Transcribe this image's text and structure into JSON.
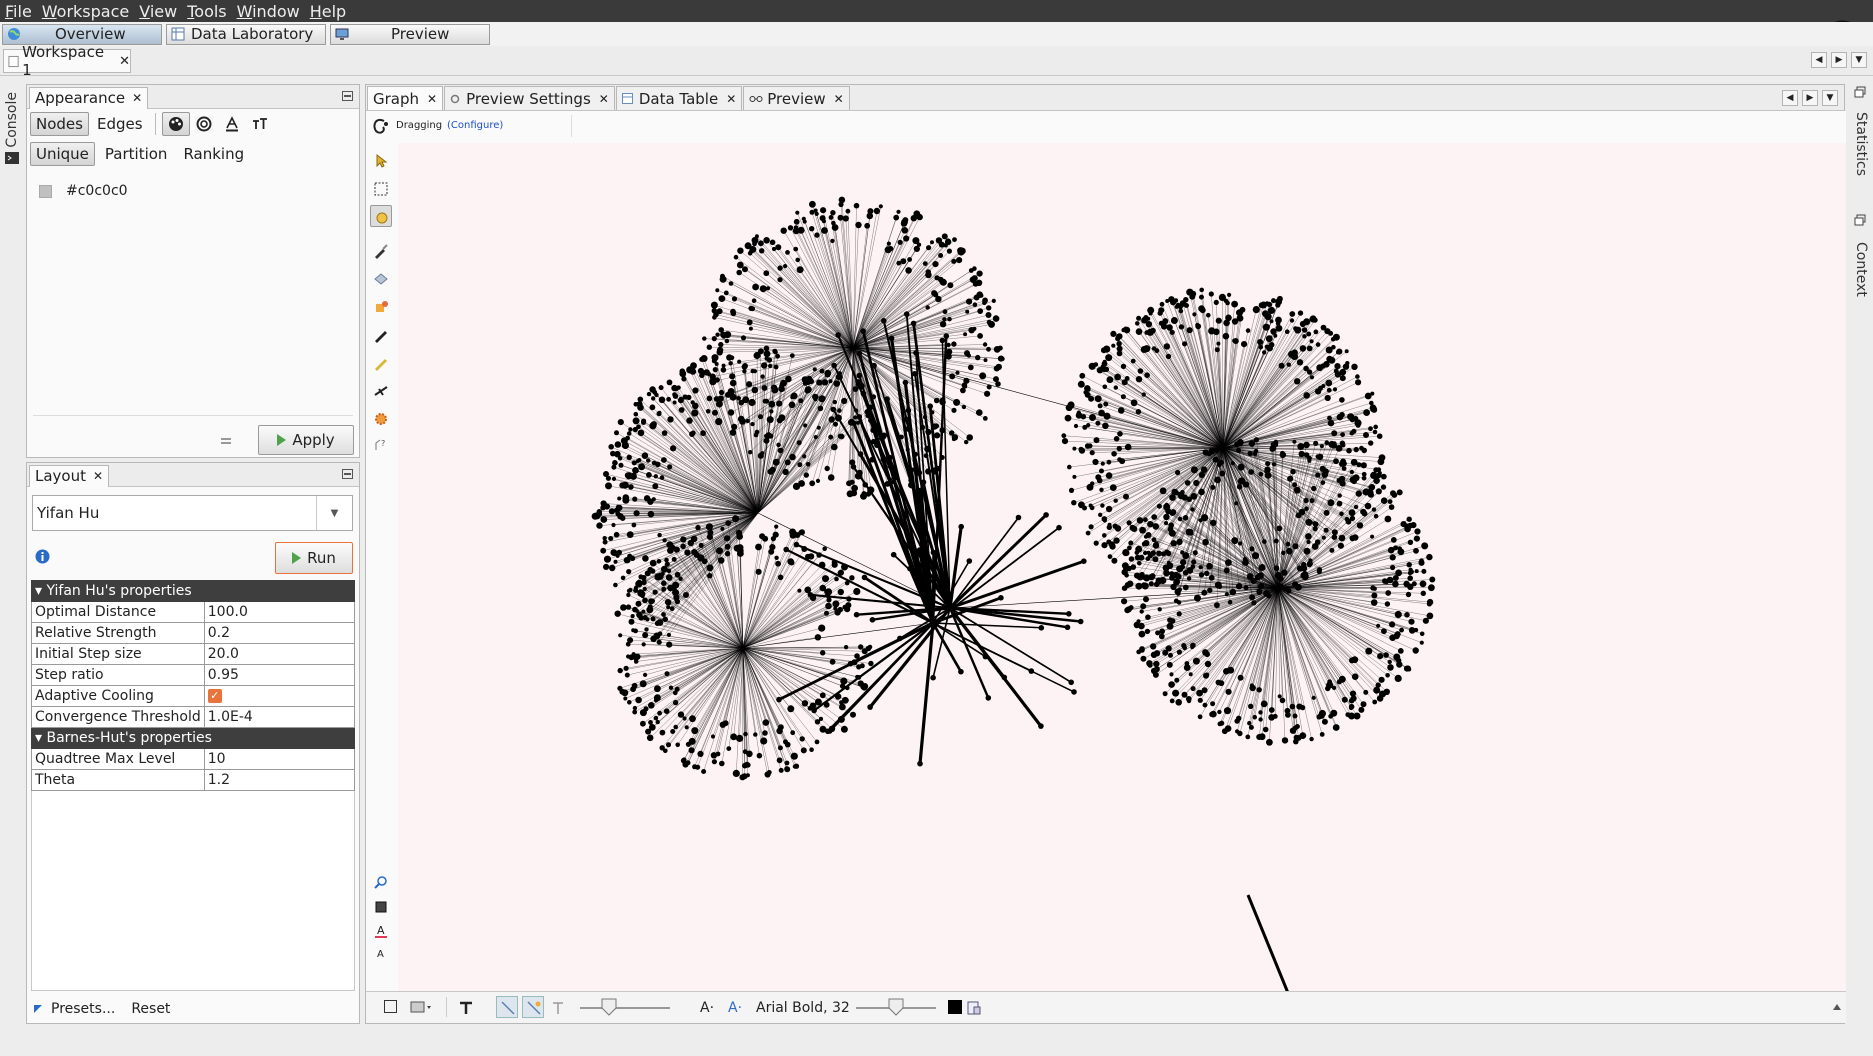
{
  "menu": [
    {
      "label": "File",
      "mnemonic": "F"
    },
    {
      "label": "Workspace",
      "mnemonic": "W"
    },
    {
      "label": "View",
      "mnemonic": "V"
    },
    {
      "label": "Tools",
      "mnemonic": "T"
    },
    {
      "label": "Window",
      "mnemonic": "W"
    },
    {
      "label": "Help",
      "mnemonic": "H"
    }
  ],
  "modes": {
    "overview": "Overview",
    "data_laboratory": "Data Laboratory",
    "preview": "Preview",
    "active": "Overview"
  },
  "workspace": {
    "tab_label": "Workspace 1"
  },
  "side": {
    "console": "Console",
    "statistics": "Statistics",
    "context": "Context"
  },
  "appearance": {
    "tab_label": "Appearance",
    "element_tabs": [
      "Nodes",
      "Edges"
    ],
    "active_element": "Nodes",
    "mode_tabs": [
      "Unique",
      "Partition",
      "Ranking"
    ],
    "active_mode": "Unique",
    "color_value": "#c0c0c0",
    "apply_label": "Apply"
  },
  "layout": {
    "tab_label": "Layout",
    "algorithm": "Yifan Hu",
    "run_label": "Run",
    "sections": [
      {
        "title": "Yifan Hu's properties",
        "rows": [
          {
            "key": "Optimal Distance",
            "value": "100.0"
          },
          {
            "key": "Relative Strength",
            "value": "0.2"
          },
          {
            "key": "Initial Step size",
            "value": "20.0"
          },
          {
            "key": "Step ratio",
            "value": "0.95"
          },
          {
            "key": "Adaptive Cooling",
            "value": "",
            "checked": true
          },
          {
            "key": "Convergence Threshold",
            "value": "1.0E-4"
          }
        ]
      },
      {
        "title": "Barnes-Hut's properties",
        "rows": [
          {
            "key": "Quadtree Max Level",
            "value": "10"
          },
          {
            "key": "Theta",
            "value": "1.2"
          }
        ]
      }
    ],
    "presets_label": "Presets...",
    "reset_label": "Reset"
  },
  "graph_tabs": [
    {
      "label": "Graph",
      "active": true
    },
    {
      "label": "Preview Settings",
      "active": false
    },
    {
      "label": "Data Table",
      "active": false
    },
    {
      "label": "Preview",
      "active": false
    }
  ],
  "graph": {
    "tool_status": "Dragging",
    "configure_label": "(Configure)",
    "font_label": "Arial Bold, 32",
    "node_color": "#000000",
    "background_color": "#fdf3f5",
    "accent_color": "#e9743b"
  }
}
